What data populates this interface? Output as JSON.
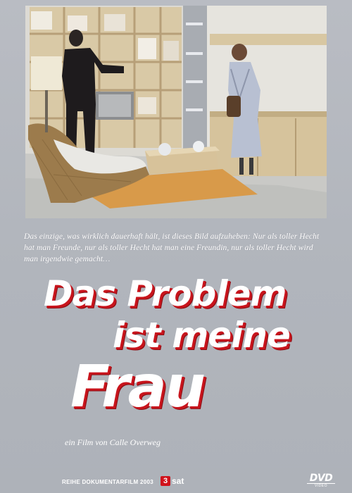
{
  "cover": {
    "tagline": "Das einzige, was wirklich dauerhaft hält, ist dieses Bild aufzuheben: Nur als toller Hecht hat man Freunde, nur als toller Hecht hat man eine Freundin, nur als toller Hecht wird man irgendwie gemacht…",
    "title_line1": "Das Problem",
    "title_line2": "ist meine",
    "title_line3": "Frau",
    "credit": "ein Film von Calle Overweg",
    "series_label": "REIHE DOKUMENTARFILM 2003",
    "broadcaster_digit": "3",
    "broadcaster_name": "sat",
    "dvd_label": "DVD",
    "dvd_sub": "VIDEO"
  },
  "colors": {
    "background": "#b3b7be",
    "title_fill": "#ffffff",
    "title_shadow": "#c8141c",
    "broadcaster_red": "#d0121b"
  },
  "icons": {
    "photo": "showroom-photo",
    "broadcaster": "3sat-logo",
    "format": "dvd-logo"
  }
}
